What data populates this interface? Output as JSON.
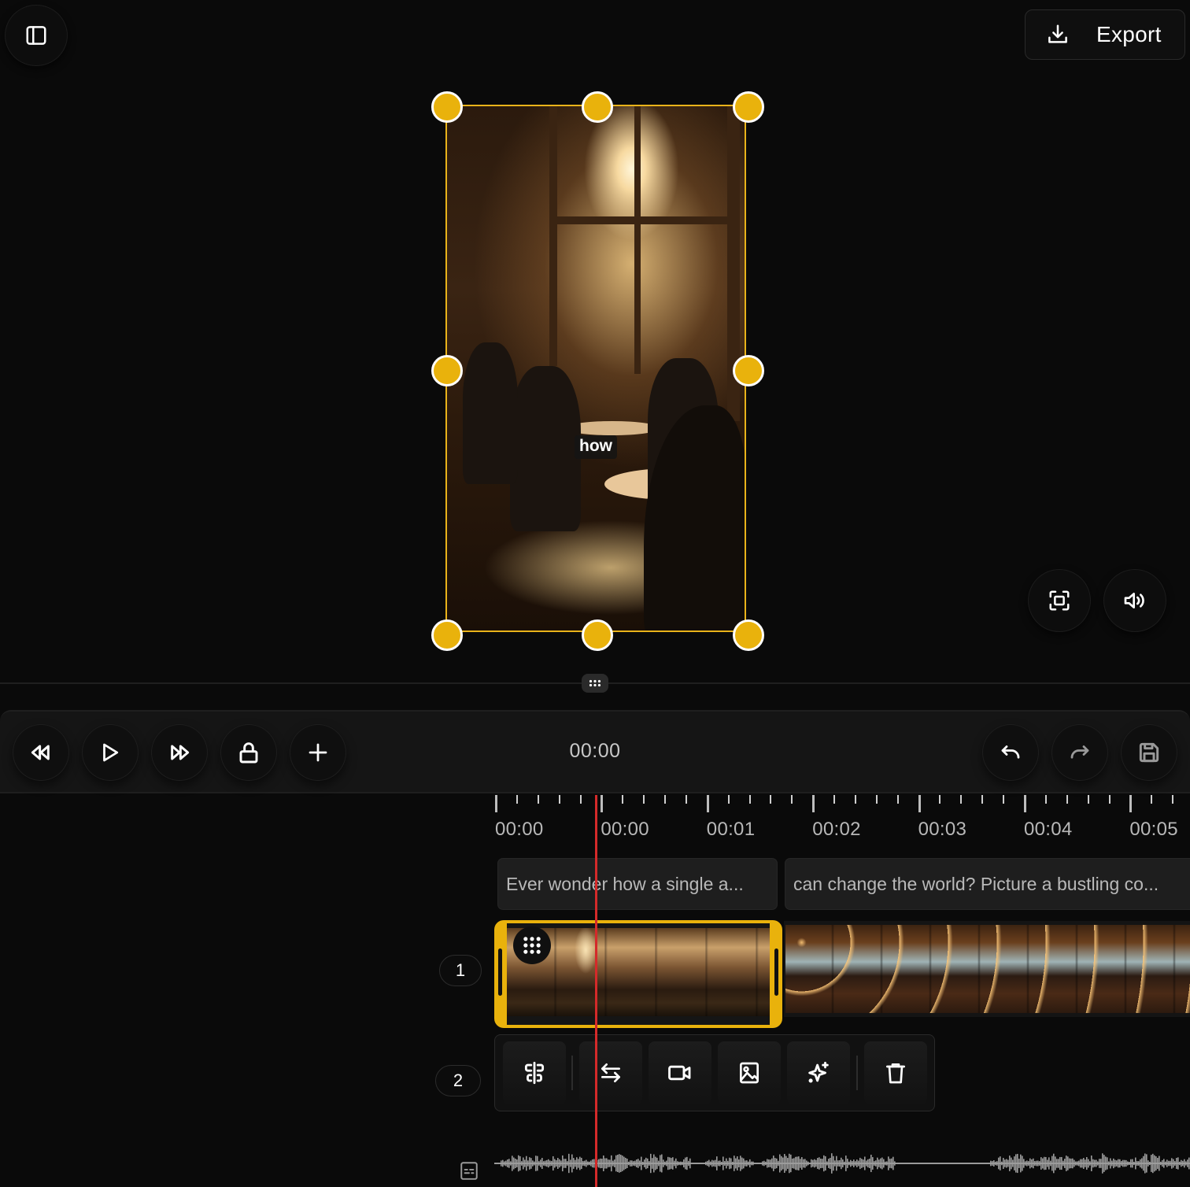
{
  "header": {
    "sidebar_toggle_icon": "sidebar-panel-icon",
    "export_label": "Export",
    "export_icon": "download-icon"
  },
  "preview": {
    "caption_word": "how",
    "selection_color": "#e9b20c",
    "handles": [
      "top-left",
      "top-center",
      "top-right",
      "middle-left",
      "middle-right",
      "bottom-left",
      "bottom-center",
      "bottom-right"
    ],
    "controls": [
      {
        "name": "fit-to-screen",
        "icon": "focus-frame-icon"
      },
      {
        "name": "volume",
        "icon": "speaker-icon"
      }
    ]
  },
  "transport": {
    "buttons_left": [
      {
        "name": "rewind",
        "icon": "rewind-icon"
      },
      {
        "name": "play",
        "icon": "play-icon"
      },
      {
        "name": "fast-forward",
        "icon": "fast-forward-icon"
      },
      {
        "name": "lock",
        "icon": "lock-icon"
      },
      {
        "name": "add",
        "icon": "plus-icon"
      }
    ],
    "timecode": "00:00",
    "buttons_right": [
      {
        "name": "undo",
        "icon": "undo-icon",
        "enabled": true
      },
      {
        "name": "redo",
        "icon": "redo-icon",
        "enabled": false
      },
      {
        "name": "save",
        "icon": "save-icon",
        "enabled": false
      }
    ]
  },
  "timeline": {
    "ruler_labels": [
      "00:00",
      "00:00",
      "00:01",
      "00:02",
      "00:03",
      "00:04",
      "00:05"
    ],
    "playhead_color": "#d42a2a",
    "captions": [
      {
        "text": "Ever wonder how a single a..."
      },
      {
        "text": "can change the world? Picture a bustling co..."
      }
    ],
    "tracks": [
      {
        "number": "1",
        "type": "video"
      },
      {
        "number": "2",
        "type": "toolbar"
      }
    ],
    "clip_tools": [
      {
        "name": "split",
        "icon": "split-icon"
      },
      {
        "name": "swap",
        "icon": "swap-arrows-icon"
      },
      {
        "name": "video",
        "icon": "video-camera-icon"
      },
      {
        "name": "image",
        "icon": "image-icon"
      },
      {
        "name": "ai-magic",
        "icon": "sparkles-icon"
      },
      {
        "name": "delete",
        "icon": "trash-icon"
      }
    ],
    "audio_track_icon": "subtitles-icon"
  }
}
